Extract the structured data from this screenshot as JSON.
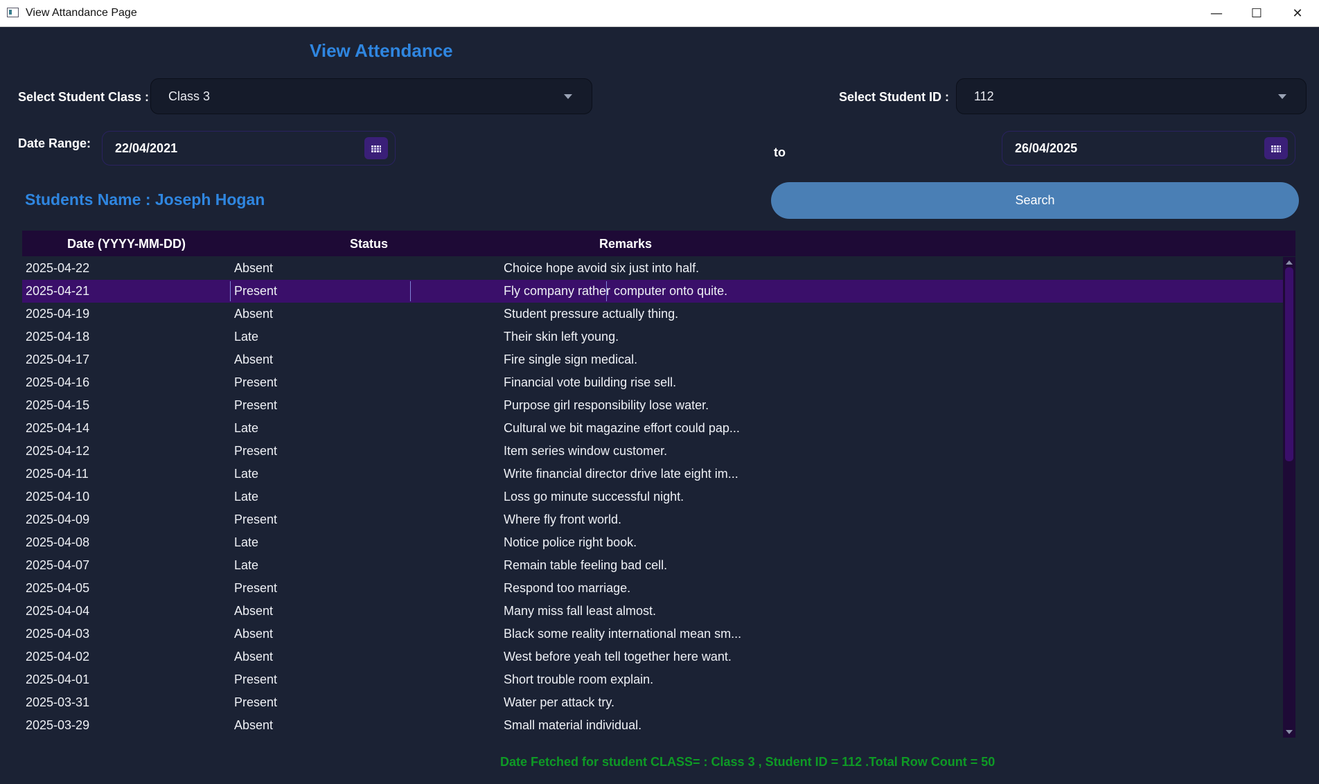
{
  "window": {
    "title": "View Attandance Page",
    "minimize": "—",
    "maximize": "☐",
    "close": "✕"
  },
  "header": {
    "title": "View Attendance"
  },
  "filters": {
    "class_label": "Select Student Class :",
    "class_value": "Class 3",
    "id_label": "Select Student ID :",
    "id_value": "112",
    "date_label": "Date Range:",
    "date_from": "22/04/2021",
    "to_label": "to",
    "date_to": "26/04/2025"
  },
  "student": {
    "name_text": "Students Name : Joseph Hogan"
  },
  "search": {
    "label": "Search"
  },
  "table": {
    "columns": [
      "Date (YYYY-MM-DD)",
      "Status",
      "Remarks"
    ],
    "selected_row": 1,
    "rows": [
      [
        "2025-04-22",
        "Absent",
        "Choice hope avoid six just into half."
      ],
      [
        "2025-04-21",
        "Present",
        "Fly company rather computer onto quite."
      ],
      [
        "2025-04-19",
        "Absent",
        "Student pressure actually thing."
      ],
      [
        "2025-04-18",
        "Late",
        "Their skin left young."
      ],
      [
        "2025-04-17",
        "Absent",
        "Fire single sign medical."
      ],
      [
        "2025-04-16",
        "Present",
        "Financial vote building rise sell."
      ],
      [
        "2025-04-15",
        "Present",
        "Purpose girl responsibility lose water."
      ],
      [
        "2025-04-14",
        "Late",
        "Cultural we bit magazine effort could pap..."
      ],
      [
        "2025-04-12",
        "Present",
        "Item series window customer."
      ],
      [
        "2025-04-11",
        "Late",
        "Write financial director drive late eight im..."
      ],
      [
        "2025-04-10",
        "Late",
        "Loss go minute successful night."
      ],
      [
        "2025-04-09",
        "Present",
        "Where fly front world."
      ],
      [
        "2025-04-08",
        "Late",
        "Notice police right book."
      ],
      [
        "2025-04-07",
        "Late",
        "Remain table feeling bad cell."
      ],
      [
        "2025-04-05",
        "Present",
        "Respond too marriage."
      ],
      [
        "2025-04-04",
        "Absent",
        "Many miss fall least almost."
      ],
      [
        "2025-04-03",
        "Absent",
        "Black some reality international mean sm..."
      ],
      [
        "2025-04-02",
        "Absent",
        "West before yeah tell together here want."
      ],
      [
        "2025-04-01",
        "Present",
        "Short trouble room explain."
      ],
      [
        "2025-03-31",
        "Present",
        "Water per attack try."
      ],
      [
        "2025-03-29",
        "Absent",
        "Small material individual."
      ]
    ]
  },
  "status_bar": {
    "text": "Date Fetched for student CLASS= : Class 3 , Student ID = 112 .Total Row Count = 50"
  },
  "colors": {
    "background": "#1b2234",
    "accent_blue": "#2f86e0",
    "header_purple": "#1e0a36",
    "selection_purple": "#3a0f6a",
    "search_button": "#4a7fb5",
    "status_green": "#0e9a25"
  }
}
